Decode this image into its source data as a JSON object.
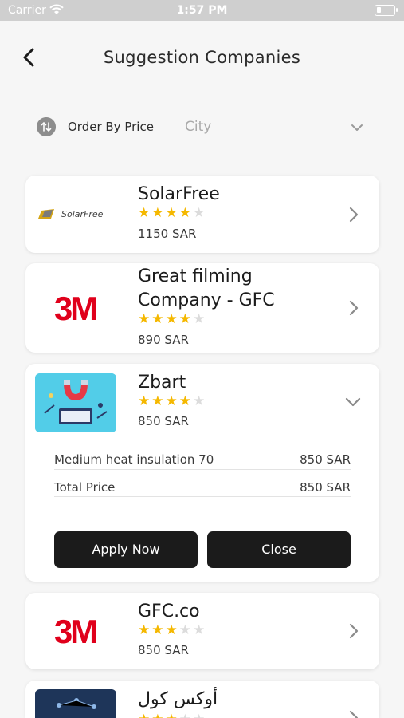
{
  "status_bar": {
    "carrier": "Carrier",
    "time": "1:57 PM"
  },
  "header": {
    "title": "Suggestion Companies",
    "back_icon": "chevron-left-icon"
  },
  "filter": {
    "sort_label": "Order By Price",
    "city_placeholder": "City",
    "sort_icon": "sort-icon"
  },
  "companies": [
    {
      "name": "SolarFree",
      "rating": 4,
      "rating_max": 5,
      "price": "1150 SAR",
      "logo_text": "SolarFree",
      "expanded": false
    },
    {
      "name_line1": "Great filming",
      "name_line2": "Company - GFC",
      "rating": 4,
      "rating_max": 5,
      "price": "890 SAR",
      "logo_text": "3M",
      "expanded": false
    },
    {
      "name": "Zbart",
      "rating": 4,
      "rating_max": 5,
      "price": "850 SAR",
      "expanded": true,
      "items": [
        {
          "label": "Medium heat insulation 70",
          "value": "850 SAR"
        }
      ],
      "total": {
        "label": "Total Price",
        "value": "850 SAR"
      },
      "apply_label": "Apply Now",
      "close_label": "Close"
    },
    {
      "name": "GFC.co",
      "rating": 3,
      "rating_max": 5,
      "price": "850 SAR",
      "logo_text": "3M",
      "expanded": false
    },
    {
      "name": "أوكس كول",
      "rating": 3,
      "rating_max": 5,
      "expanded": false
    }
  ],
  "colors": {
    "star": "#f5b800",
    "star_empty": "#dcdcdc",
    "brand_3m": "#e0001b",
    "button": "#1b1b1b"
  }
}
